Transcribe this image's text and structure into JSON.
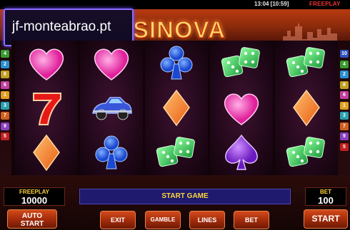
{
  "status_bar": {
    "time": "13:04 [10:59]",
    "mode": "FREEPLAY"
  },
  "header": {
    "logo_text": "SINOVA"
  },
  "watermark": {
    "text": "jf-monteabrao.pt"
  },
  "left_line_numbers": [
    "4",
    "2",
    "8",
    "6",
    "1",
    "3",
    "7",
    "9",
    "5"
  ],
  "right_line_numbers": [
    "10",
    "4",
    "2",
    "8",
    "6",
    "1",
    "3",
    "7",
    "9",
    "5"
  ],
  "line_colors": [
    "#e0a020",
    "#2a8fd0",
    "#2aa0b0",
    "#3a9a30",
    "#c02020",
    "#c040a0",
    "#d06020",
    "#c0a020",
    "#8a40c0",
    "#3050c0"
  ],
  "reels": [
    [
      "pink-heart",
      "red-seven",
      "orange-diamond"
    ],
    [
      "pink-heart",
      "blue-car",
      "blue-club"
    ],
    [
      "blue-club",
      "orange-diamond",
      "green-dice"
    ],
    [
      "green-dice",
      "pink-heart",
      "purple-spade"
    ],
    [
      "green-dice",
      "orange-diamond",
      "green-dice"
    ]
  ],
  "freeplay": {
    "label": "FREEPLAY",
    "value": "10000"
  },
  "message": "START GAME",
  "bet": {
    "label": "BET",
    "value": "100"
  },
  "buttons": {
    "autostart": [
      "AUTO",
      "START"
    ],
    "exit": "EXIT",
    "gamble": "GAMBLE",
    "lines": "LINES",
    "bet": "BET",
    "start": "START"
  }
}
